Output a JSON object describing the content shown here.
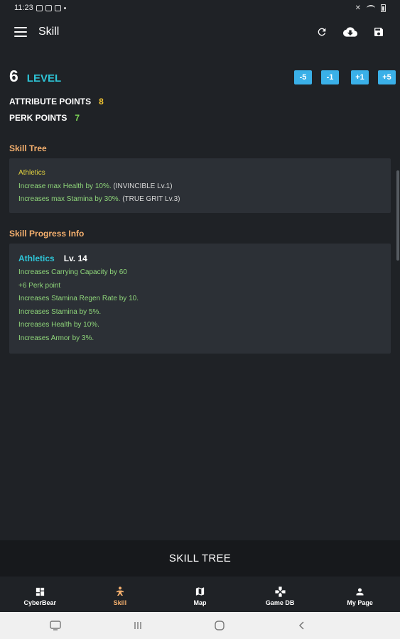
{
  "status_bar": {
    "time": "11:23"
  },
  "app_bar": {
    "title": "Skill"
  },
  "level": {
    "value": "6",
    "label": "LEVEL",
    "buttons": [
      "-5",
      "-1",
      "+1",
      "+5"
    ]
  },
  "stats": {
    "attribute_points_label": "ATTRIBUTE POINTS",
    "attribute_points_value": "8",
    "perk_points_label": "PERK POINTS",
    "perk_points_value": "7"
  },
  "skill_tree": {
    "title": "Skill Tree",
    "skill_name": "Athletics",
    "perks": [
      {
        "text": "Increase max Health by 10%.",
        "tag": "(INVINCIBLE Lv.1)"
      },
      {
        "text": "Increases max Stamina by 30%.",
        "tag": "(TRUE GRIT Lv.3)"
      }
    ]
  },
  "skill_progress": {
    "title": "Skill Progress Info",
    "skill_name": "Athletics",
    "level": "Lv. 14",
    "lines": [
      "Increases Carrying Capacity by 60",
      "+6 Perk point",
      "Increases Stamina Regen Rate by 10.",
      "Increases Stamina by 5%.",
      "Increases Health by 10%.",
      "Increases Armor by 3%."
    ]
  },
  "bottom_button": {
    "label": "SKILL TREE"
  },
  "tabs": [
    {
      "label": "CyberBear",
      "icon": "dashboard-icon"
    },
    {
      "label": "Skill",
      "icon": "skill-figure-icon"
    },
    {
      "label": "Map",
      "icon": "map-icon"
    },
    {
      "label": "Game DB",
      "icon": "gamepad-icon"
    },
    {
      "label": "My Page",
      "icon": "person-icon"
    }
  ],
  "colors": {
    "background": "#1f2226",
    "card": "#2c3036",
    "accent_cyan": "#2ec4d6",
    "section_orange": "#f5b06e",
    "perk_green": "#8fd67a",
    "button_blue": "#3ab0e8"
  }
}
